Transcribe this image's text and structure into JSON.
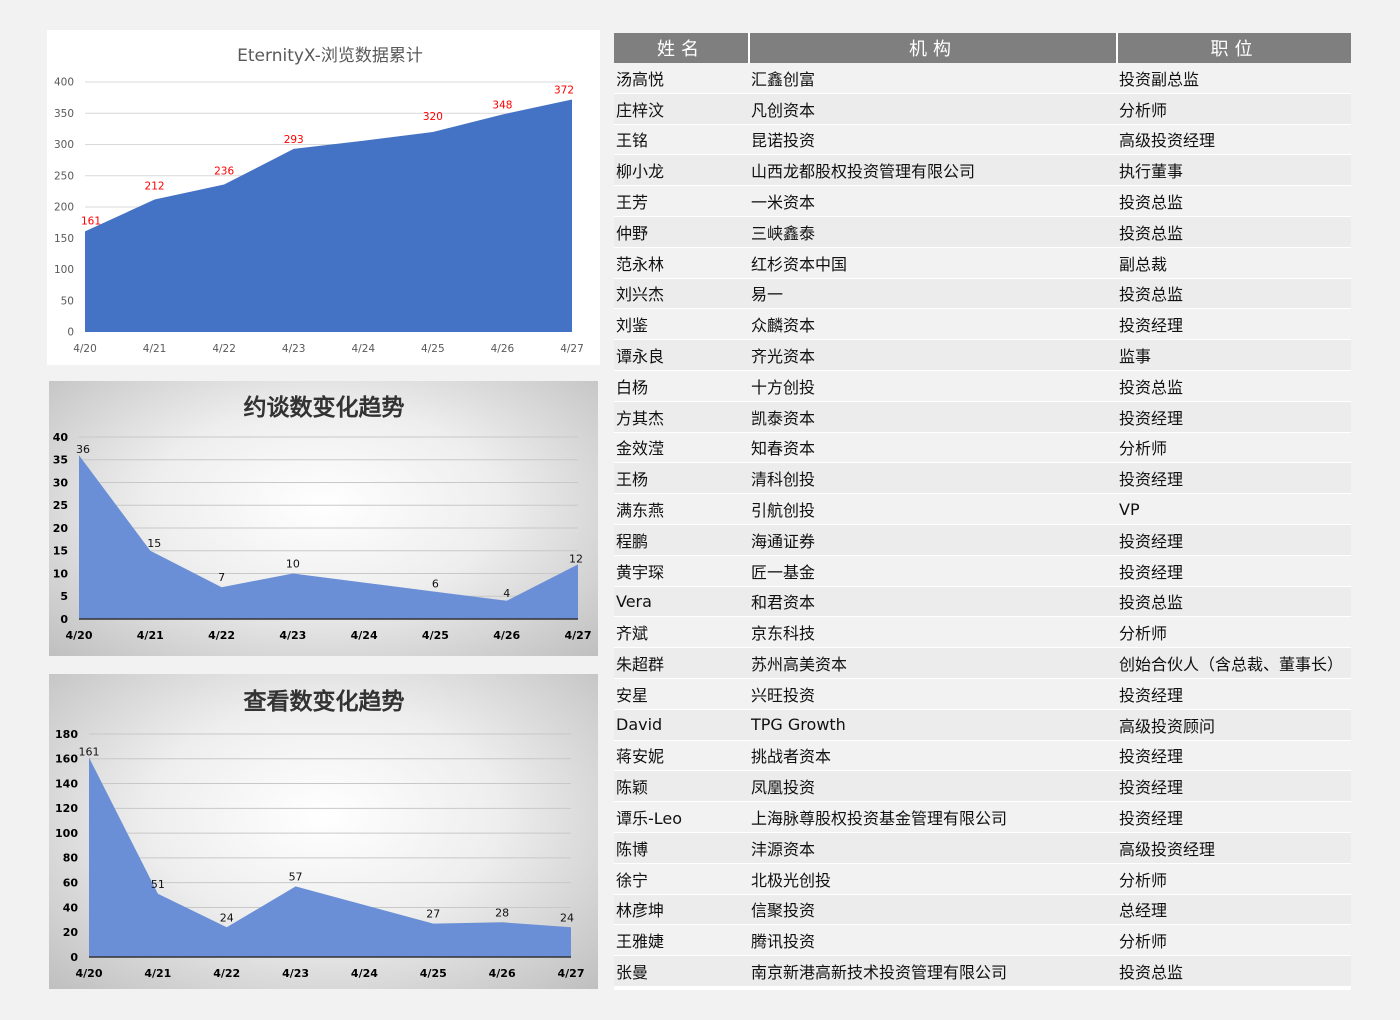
{
  "chart_data": [
    {
      "type": "area",
      "title": "EternityX-浏览数据累计",
      "categories": [
        "4/20",
        "4/21",
        "4/22",
        "4/23",
        "4/24",
        "4/25",
        "4/26",
        "4/27"
      ],
      "values": [
        161,
        212,
        236,
        293,
        null,
        320,
        348,
        372
      ],
      "series_points": [
        161,
        212,
        236,
        293,
        306,
        320,
        348,
        372
      ],
      "yticks": [
        "0",
        "50",
        "100",
        "150",
        "200",
        "250",
        "300",
        "350",
        "400"
      ],
      "ylim": [
        0,
        400
      ],
      "data_labels": [
        "161",
        "212",
        "236",
        "293",
        "",
        "320",
        "348",
        "372"
      ],
      "fill_color": "#4472c4",
      "label_color": "#ff0000",
      "grid": true
    },
    {
      "type": "area",
      "title": "约谈数变化趋势",
      "categories": [
        "4/20",
        "4/21",
        "4/22",
        "4/23",
        "4/24",
        "4/25",
        "4/26",
        "4/27"
      ],
      "values": [
        36,
        15,
        7,
        10,
        null,
        6,
        4,
        12
      ],
      "series_points": [
        36,
        15,
        7,
        10,
        8,
        6,
        4,
        12
      ],
      "yticks": [
        "0",
        "5",
        "10",
        "15",
        "20",
        "25",
        "30",
        "35",
        "40"
      ],
      "ylim": [
        0,
        40
      ],
      "data_labels": [
        "36",
        "15",
        "7",
        "10",
        "",
        "6",
        "4",
        "12"
      ],
      "fill_color": "#6b8fd6",
      "label_color": "#111111",
      "grid": true
    },
    {
      "type": "area",
      "title": "查看数变化趋势",
      "categories": [
        "4/20",
        "4/21",
        "4/22",
        "4/23",
        "4/24",
        "4/25",
        "4/26",
        "4/27"
      ],
      "values": [
        161,
        51,
        24,
        57,
        null,
        27,
        28,
        24
      ],
      "series_points": [
        161,
        51,
        24,
        57,
        42,
        27,
        28,
        24
      ],
      "yticks": [
        "0",
        "20",
        "40",
        "60",
        "80",
        "100",
        "120",
        "140",
        "160",
        "180"
      ],
      "ylim": [
        0,
        180
      ],
      "data_labels": [
        "161",
        "51",
        "24",
        "57",
        "",
        "27",
        "28",
        "24"
      ],
      "fill_color": "#6b8fd6",
      "label_color": "#111111",
      "grid": true
    }
  ],
  "table": {
    "headers": [
      "姓名",
      "机构",
      "职位"
    ],
    "rows": [
      [
        "汤高悦",
        "汇鑫创富",
        "投资副总监"
      ],
      [
        "庄梓汶",
        "凡创资本",
        "分析师"
      ],
      [
        "王铭",
        "昆诺投资",
        "高级投资经理"
      ],
      [
        "柳小龙",
        "山西龙都股权投资管理有限公司",
        "执行董事"
      ],
      [
        "王芳",
        "一米资本",
        "投资总监"
      ],
      [
        "仲野",
        "三峡鑫泰",
        "投资总监"
      ],
      [
        "范永林",
        "红杉资本中国",
        "副总裁"
      ],
      [
        "刘兴杰",
        "易一",
        "投资总监"
      ],
      [
        "刘鉴",
        "众麟资本",
        "投资经理"
      ],
      [
        "谭永良",
        "齐光资本",
        "监事"
      ],
      [
        "白杨",
        "十方创投",
        "投资总监"
      ],
      [
        "方其杰",
        "凯泰资本",
        "投资经理"
      ],
      [
        "金效滢",
        "知春资本",
        "分析师"
      ],
      [
        "王杨",
        "清科创投",
        "投资经理"
      ],
      [
        "满东燕",
        "引航创投",
        "VP"
      ],
      [
        "程鹏",
        "海通证券",
        "投资经理"
      ],
      [
        "黄宇琛",
        "匠一基金",
        "投资经理"
      ],
      [
        "Vera",
        "和君资本",
        "投资总监"
      ],
      [
        "齐斌",
        "京东科技",
        "分析师"
      ],
      [
        "朱超群",
        "苏州高美资本",
        "创始合伙人（含总裁、董事长）"
      ],
      [
        "安星",
        "兴旺投资",
        "投资经理"
      ],
      [
        "David",
        "TPG Growth",
        "高级投资顾问"
      ],
      [
        "蒋安妮",
        "挑战者资本",
        "投资经理"
      ],
      [
        "陈颖",
        "凤凰投资",
        "投资经理"
      ],
      [
        "谭乐-Leo",
        "上海脉尊股权投资基金管理有限公司",
        "投资经理"
      ],
      [
        "陈博",
        "沣源资本",
        "高级投资经理"
      ],
      [
        "徐宁",
        "北极光创投",
        "分析师"
      ],
      [
        "林彦坤",
        "信聚投资",
        "总经理"
      ],
      [
        "王雅婕",
        "腾讯投资",
        "分析师"
      ],
      [
        "张曼",
        "南京新港高新技术投资管理有限公司",
        "投资总监"
      ]
    ]
  }
}
